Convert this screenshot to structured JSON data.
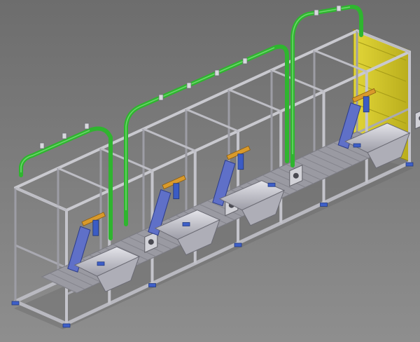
{
  "scene": {
    "subject": "cad-render-industrial-assembly-line",
    "colors": {
      "frame": "#c9c9cf",
      "frame_dark": "#8f9097",
      "green_pipe": "#2fb52f",
      "yellow_panel": "#d8cc2a",
      "hopper": "#c4c4cc",
      "blue_part": "#3b5cc4",
      "orange_part": "#d99a2b",
      "background": "#777777"
    }
  }
}
